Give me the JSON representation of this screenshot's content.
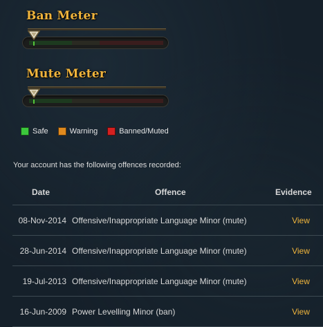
{
  "meters": {
    "ban": {
      "title": "Ban Meter",
      "level": 0
    },
    "mute": {
      "title": "Mute Meter",
      "level": 0
    }
  },
  "legend": {
    "items": [
      {
        "label": "Safe",
        "color": "#3cc83c"
      },
      {
        "label": "Warning",
        "color": "#e08a1e"
      },
      {
        "label": "Banned/Muted",
        "color": "#d42020"
      }
    ]
  },
  "intro_text": "Your account has the following offences recorded:",
  "table": {
    "headers": {
      "date": "Date",
      "offence": "Offence",
      "evidence": "Evidence"
    },
    "rows": [
      {
        "date": "08-Nov-2014",
        "offence": "Offensive/Inappropriate Language Minor (mute)",
        "evidence": "View"
      },
      {
        "date": "28-Jun-2014",
        "offence": "Offensive/Inappropriate Language Minor (mute)",
        "evidence": "View"
      },
      {
        "date": "19-Jul-2013",
        "offence": "Offensive/Inappropriate Language Minor (mute)",
        "evidence": "View"
      },
      {
        "date": "16-Jun-2009",
        "offence": "Power Levelling Minor (ban)",
        "evidence": "View"
      }
    ]
  },
  "colors": {
    "accent": "#f0b43c",
    "background": "#15202a"
  }
}
